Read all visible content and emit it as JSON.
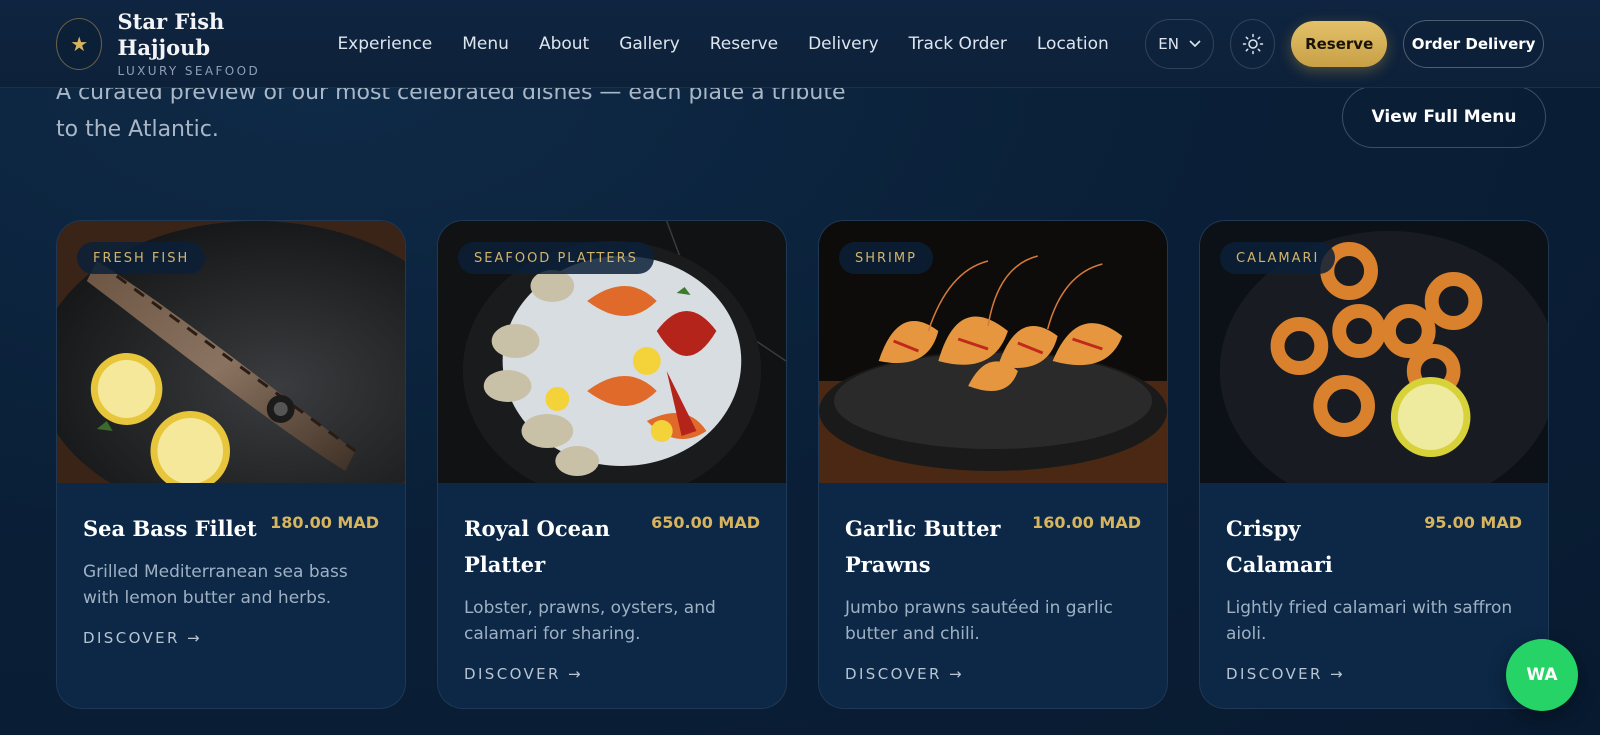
{
  "header": {
    "brand_name": "Star Fish Hajjoub",
    "brand_tagline": "LUXURY SEAFOOD",
    "nav": [
      "Experience",
      "Menu",
      "About",
      "Gallery",
      "Reserve",
      "Delivery",
      "Track Order",
      "Location"
    ],
    "language": "EN",
    "reserve_label": "Reserve",
    "order_label": "Order Delivery"
  },
  "intro": {
    "text": "A curated preview of our most celebrated dishes — each plate a tribute to the Atlantic.",
    "view_menu_label": "View Full Menu"
  },
  "cards": [
    {
      "category": "FRESH FISH",
      "title": "Sea Bass Fillet",
      "price": "180.00 MAD",
      "description": "Grilled Mediterranean sea bass with lemon butter and herbs.",
      "link": "DISCOVER →"
    },
    {
      "category": "SEAFOOD PLATTERS",
      "title": "Royal Ocean Platter",
      "price": "650.00 MAD",
      "description": "Lobster, prawns, oysters, and calamari for sharing.",
      "link": "DISCOVER →"
    },
    {
      "category": "SHRIMP",
      "title": "Garlic Butter Prawns",
      "price": "160.00 MAD",
      "description": "Jumbo prawns sautéed in garlic butter and chili.",
      "link": "DISCOVER →"
    },
    {
      "category": "CALAMARI",
      "title": "Crispy Calamari",
      "price": "95.00 MAD",
      "description": "Lightly fried calamari with saffron aioli.",
      "link": "DISCOVER →"
    }
  ],
  "whatsapp_label": "WA",
  "colors": {
    "accent_gold": "#d7b45e",
    "background": "#0a2038",
    "card_bg": "#0c2846",
    "whatsapp_green": "#25d366"
  }
}
